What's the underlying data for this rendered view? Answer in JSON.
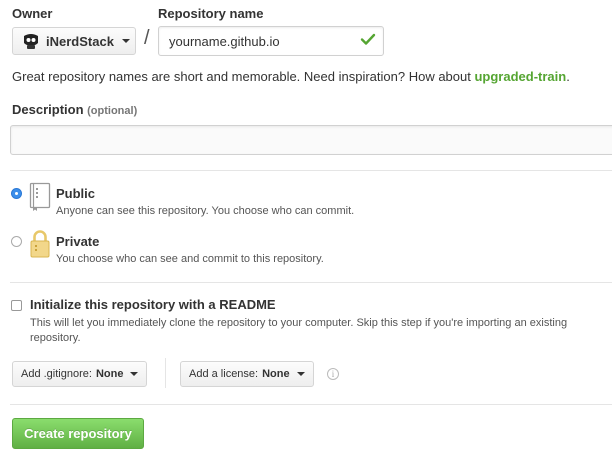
{
  "owner": {
    "label": "Owner",
    "value": "iNerdStack"
  },
  "repo": {
    "label": "Repository name",
    "separator": "/",
    "value": "yourname.github.io"
  },
  "hint": {
    "text": "Great repository names are short and memorable. Need inspiration? How about ",
    "suggestion": "upgraded-train",
    "end": "."
  },
  "description": {
    "label": "Description",
    "optional": "(optional)",
    "value": ""
  },
  "visibility": {
    "public": {
      "title": "Public",
      "subtitle": "Anyone can see this repository. You choose who can commit.",
      "selected": true
    },
    "private": {
      "title": "Private",
      "subtitle": "You choose who can see and commit to this repository.",
      "selected": false
    }
  },
  "readme": {
    "label": "Initialize this repository with a README",
    "help_line1": "This will let you immediately clone the repository to your computer. Skip this step if you're importing an existing",
    "help_line2": "repository.",
    "checked": false
  },
  "gitignore": {
    "prefix": "Add .gitignore:",
    "value": "None"
  },
  "license": {
    "prefix": "Add a license:",
    "value": "None"
  },
  "info_icon": "i",
  "create_button": "Create repository",
  "colors": {
    "accent_green": "#55a532",
    "button_green": "#60b044",
    "radio_blue": "#3b8eea"
  }
}
